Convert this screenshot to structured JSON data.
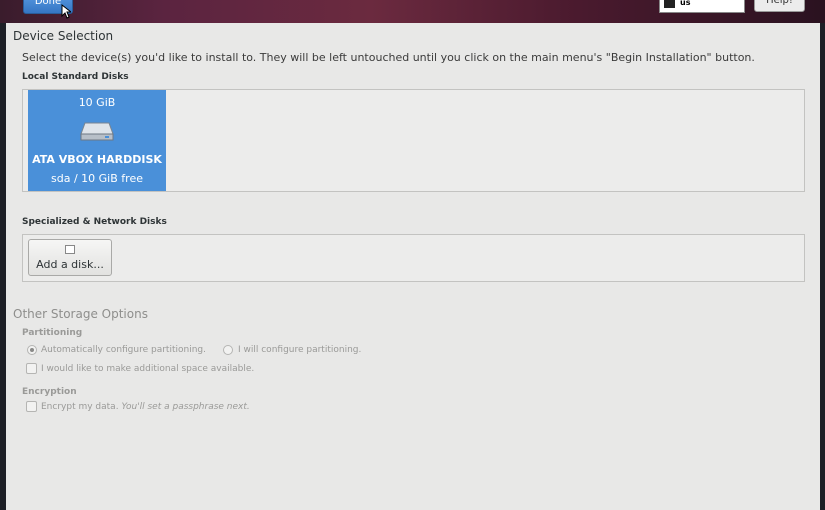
{
  "header": {
    "done_label": "Done",
    "keyboard_layout": "us",
    "help_label": "Help!"
  },
  "device_selection": {
    "title": "Device Selection",
    "description": "Select the device(s) you'd like to install to.  They will be left untouched until you click on the main menu's \"Begin Installation\" button.",
    "local_disks_label": "Local Standard Disks",
    "disk": {
      "size": "10 GiB",
      "name": "ATA VBOX HARDDISK",
      "details": "sda   /   10 GiB free",
      "icon": "harddisk-icon"
    },
    "network_disks_label": "Specialized & Network Disks",
    "add_disk_label": "Add a disk..."
  },
  "other_storage": {
    "title": "Other Storage Options",
    "partitioning_label": "Partitioning",
    "auto_partition_label": "Automatically configure partitioning.",
    "manual_partition_label": "I will configure partitioning.",
    "additional_space_label": "I would like to make additional space available.",
    "encryption_label": "Encryption",
    "encrypt_label": "Encrypt my data.",
    "encrypt_note": "You'll set a passphrase next."
  },
  "colors": {
    "selected_disk": "#4a90d9",
    "done_button": "#4a86cf"
  }
}
